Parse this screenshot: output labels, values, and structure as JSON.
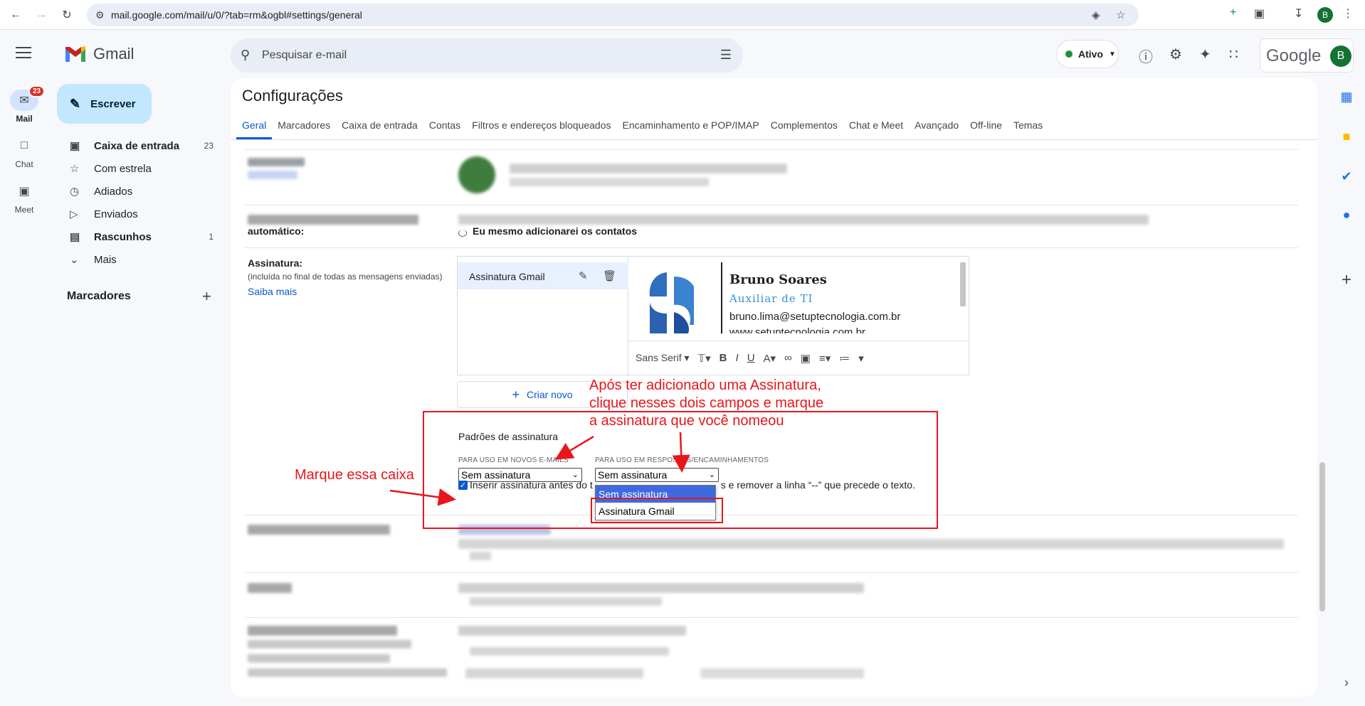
{
  "browser": {
    "url": "mail.google.com/mail/u/0/?tab=rm&ogbl#settings/general",
    "profile_initial": "B"
  },
  "header": {
    "brand": "Gmail",
    "search_placeholder": "Pesquisar e-mail",
    "status_label": "Ativo",
    "google_word": "Google",
    "avatar_initial": "B"
  },
  "rail": {
    "mail_label": "Mail",
    "mail_badge": "23",
    "chat_label": "Chat",
    "meet_label": "Meet"
  },
  "sidebar": {
    "compose_label": "Escrever",
    "items": [
      {
        "label": "Caixa de entrada",
        "count": "23",
        "icon": "inbox-icon"
      },
      {
        "label": "Com estrela",
        "count": "",
        "icon": "star-icon"
      },
      {
        "label": "Adiados",
        "count": "",
        "icon": "clock-icon"
      },
      {
        "label": "Enviados",
        "count": "",
        "icon": "send-icon"
      },
      {
        "label": "Rascunhos",
        "count": "1",
        "icon": "draft-icon"
      },
      {
        "label": "Mais",
        "count": "",
        "icon": "chevron-down-icon"
      }
    ],
    "labels_heading": "Marcadores"
  },
  "settings": {
    "title": "Configurações",
    "tabs": [
      "Geral",
      "Marcadores",
      "Caixa de entrada",
      "Contas",
      "Filtros e endereços bloqueados",
      "Encaminhamento e POP/IMAP",
      "Complementos",
      "Chat e Meet",
      "Avançado",
      "Off-line",
      "Temas"
    ],
    "contacts_label_partial": "automático:",
    "contacts_option_partial": "Eu mesmo adicionarei os contatos",
    "signature_label": "Assinatura:",
    "signature_sub": "(incluída no final de todas as mensagens enviadas)",
    "signature_link": "Saiba mais",
    "signature_name": "Assinatura Gmail",
    "sig_person": "Bruno Soares",
    "sig_role": "Auxiliar de TI",
    "sig_email": "bruno.lima@setuptecnologia.com.br",
    "sig_web": "www.setuptecnologia.com.br",
    "toolbar_font": "Sans Serif",
    "create_new": "Criar novo",
    "defaults_heading": "Padrões de assinatura",
    "new_emails_caption": "PARA USO EM NOVOS E-MAILS",
    "replies_caption": "PARA USO EM RESPOSTAS/ENCAMINHAMENTOS",
    "new_emails_value": "Sem assinatura",
    "replies_value": "Sem assinatura",
    "dropdown_options": [
      "Sem assinatura",
      "Assinatura Gmail"
    ],
    "checkbox_text_before": "Inserir assinatura antes do t",
    "checkbox_text_after": "s e remover a linha “--” que precede o texto."
  },
  "annotations": {
    "instruction_line1": "Após ter adicionado uma Assinatura,",
    "instruction_line2": "clique nesses dois campos e marque",
    "instruction_line3": "a assinatura que você nomeou",
    "checkbox_hint": "Marque essa caixa"
  },
  "colors": {
    "accent": "#0b57d0",
    "annotation_red": "#e8161b",
    "compose_bg": "#c2e7ff"
  }
}
